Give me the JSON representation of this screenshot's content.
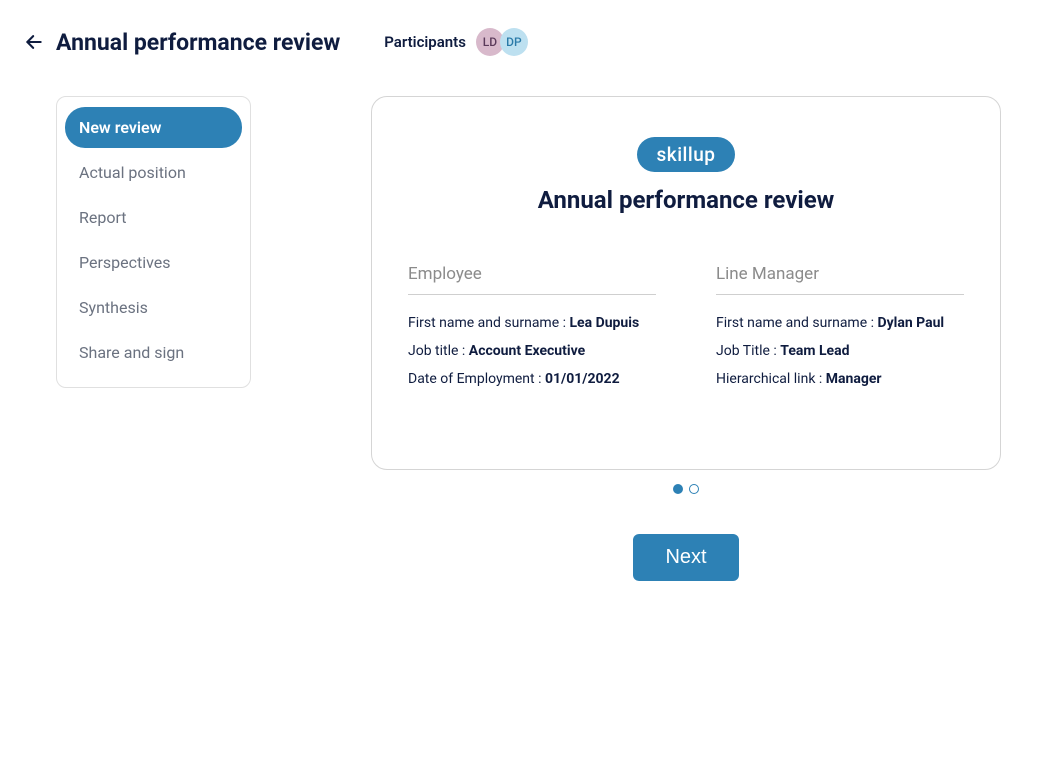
{
  "header": {
    "title": "Annual performance review",
    "participants_label": "Participants",
    "participants": [
      {
        "initials": "LD"
      },
      {
        "initials": "DP"
      }
    ]
  },
  "sidebar": {
    "items": [
      {
        "label": "New review",
        "active": true
      },
      {
        "label": "Actual position",
        "active": false
      },
      {
        "label": "Report",
        "active": false
      },
      {
        "label": "Perspectives",
        "active": false
      },
      {
        "label": "Synthesis",
        "active": false
      },
      {
        "label": "Share and sign",
        "active": false
      }
    ]
  },
  "card": {
    "brand": "skillup",
    "section_title": "Annual performance review",
    "employee": {
      "heading": "Employee",
      "name_label": "First name and surname : ",
      "name_value": "Lea Dupuis",
      "jobtitle_label": "Job title : ",
      "jobtitle_value": "Account Executive",
      "doe_label": "Date of Employment : ",
      "doe_value": "01/01/2022"
    },
    "manager": {
      "heading": "Line Manager",
      "name_label": "First name and surname : ",
      "name_value": "Dylan Paul",
      "jobtitle_label": "Job Title : ",
      "jobtitle_value": "Team Lead",
      "link_label": "Hierarchical link :  ",
      "link_value": "Manager"
    }
  },
  "actions": {
    "next_label": "Next"
  }
}
